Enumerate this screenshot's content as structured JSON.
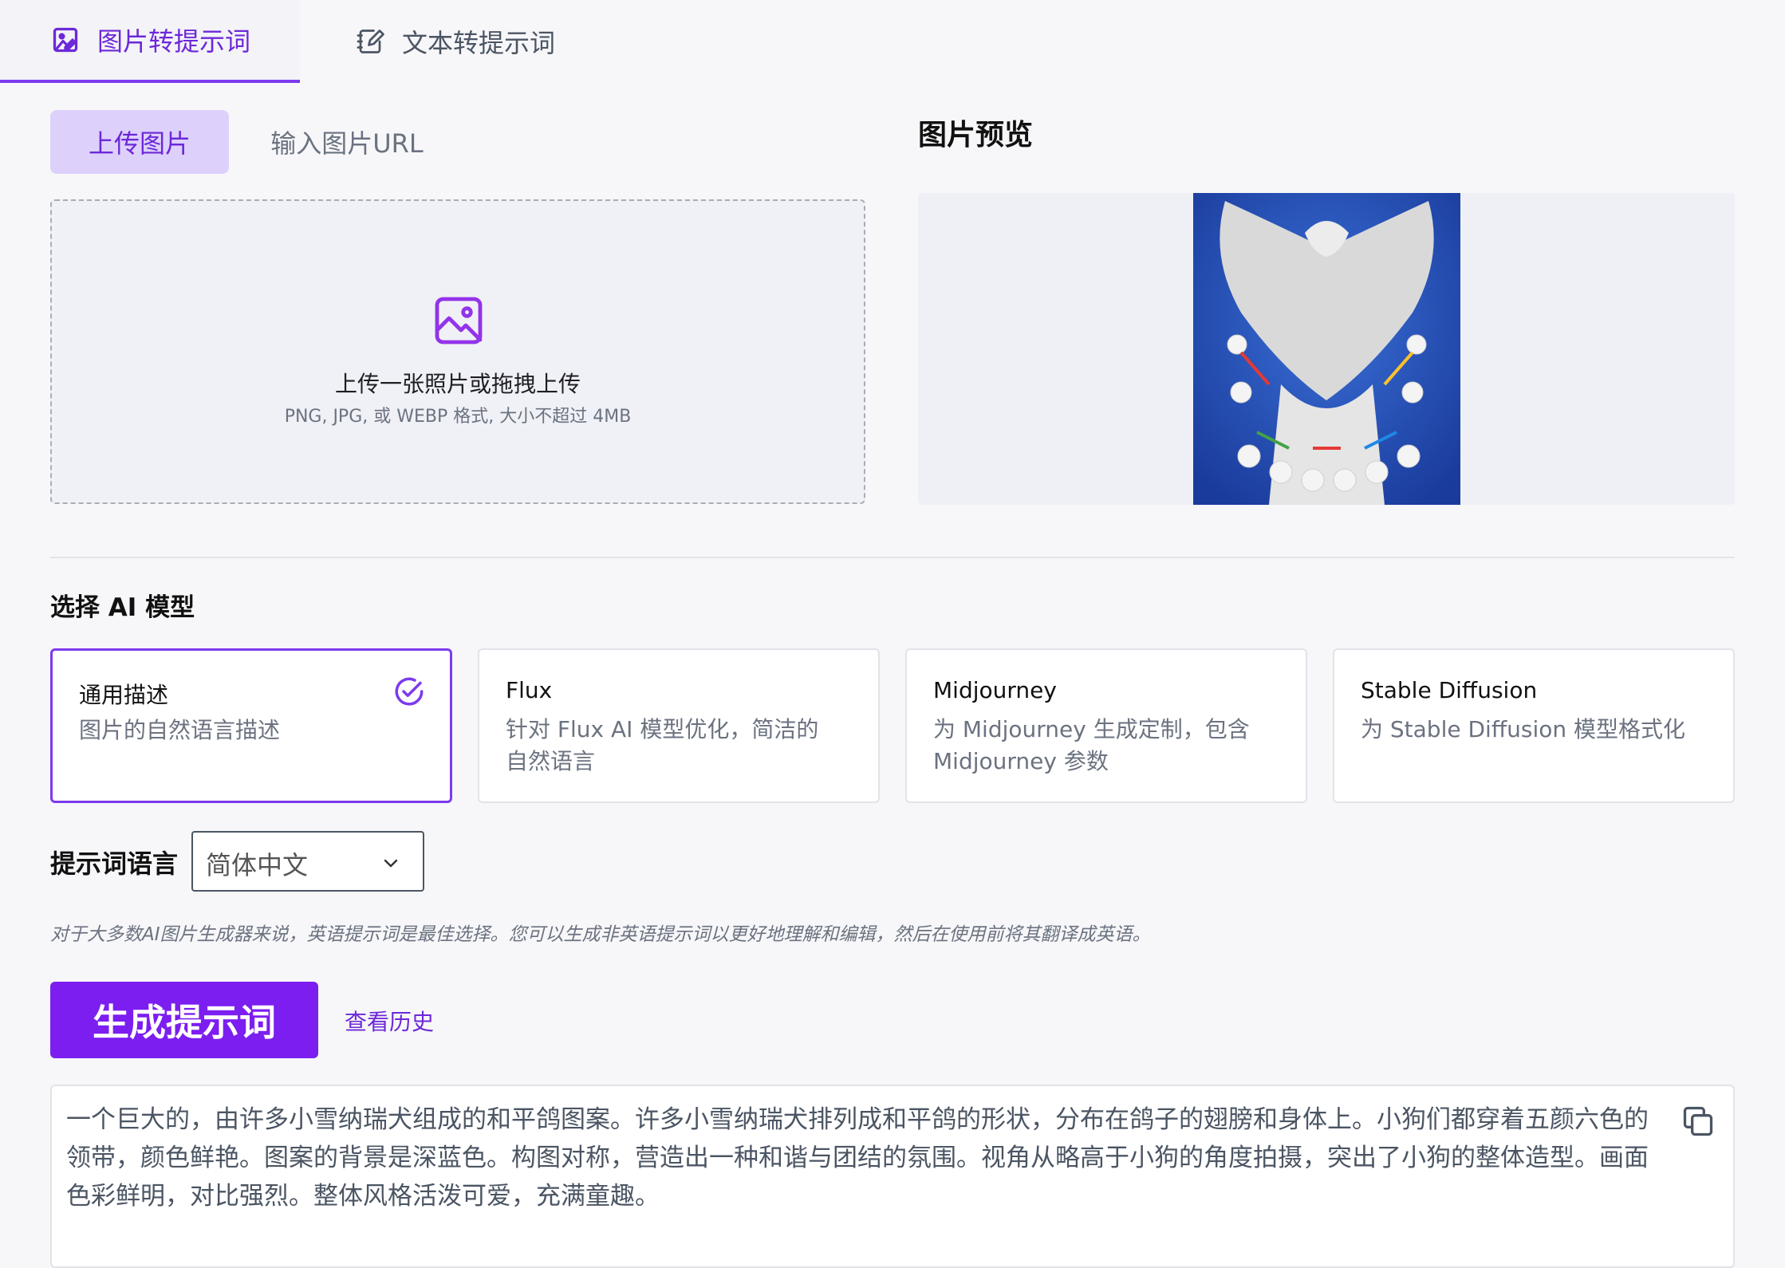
{
  "top_tabs": [
    {
      "label": "图片转提示词",
      "icon": "image-edit-icon",
      "active": true
    },
    {
      "label": "文本转提示词",
      "icon": "notebook-edit-icon",
      "active": false
    }
  ],
  "upload_tabs": [
    {
      "label": "上传图片",
      "active": true
    },
    {
      "label": "输入图片URL",
      "active": false
    }
  ],
  "dropzone": {
    "icon": "image-icon",
    "title": "上传一张照片或拖拽上传",
    "subtitle": "PNG, JPG, 或 WEBP 格式, 大小不超过 4MB"
  },
  "preview": {
    "title": "图片预览"
  },
  "model_section": {
    "title": "选择 AI 模型",
    "models": [
      {
        "name": "通用描述",
        "desc": "图片的自然语言描述",
        "selected": true
      },
      {
        "name": "Flux",
        "desc": "针对 Flux AI 模型优化，简洁的自然语言",
        "selected": false
      },
      {
        "name": "Midjourney",
        "desc": "为 Midjourney 生成定制，包含 Midjourney 参数",
        "selected": false
      },
      {
        "name": "Stable Diffusion",
        "desc": "为 Stable Diffusion 模型格式化",
        "selected": false
      }
    ]
  },
  "language": {
    "label": "提示词语言",
    "selected": "简体中文",
    "hint": "对于大多数AI图片生成器来说，英语提示词是最佳选择。您可以生成非英语提示词以更好地理解和编辑，然后在使用前将其翻译成英语。"
  },
  "actions": {
    "generate_label": "生成提示词",
    "history_label": "查看历史"
  },
  "result": {
    "text": "一个巨大的，由许多小雪纳瑞犬组成的和平鸽图案。许多小雪纳瑞犬排列成和平鸽的形状，分布在鸽子的翅膀和身体上。小狗们都穿着五颜六色的领带，颜色鲜艳。图案的背景是深蓝色。构图对称，营造出一种和谐与团结的氛围。视角从略高于小狗的角度拍摄，突出了小狗的整体造型。画面色彩鲜明，对比强烈。整体风格活泼可爱，充满童趣。"
  },
  "colors": {
    "accent": "#7c3aed",
    "button": "#7c1ef0",
    "preview_bg": "#2347a8"
  }
}
